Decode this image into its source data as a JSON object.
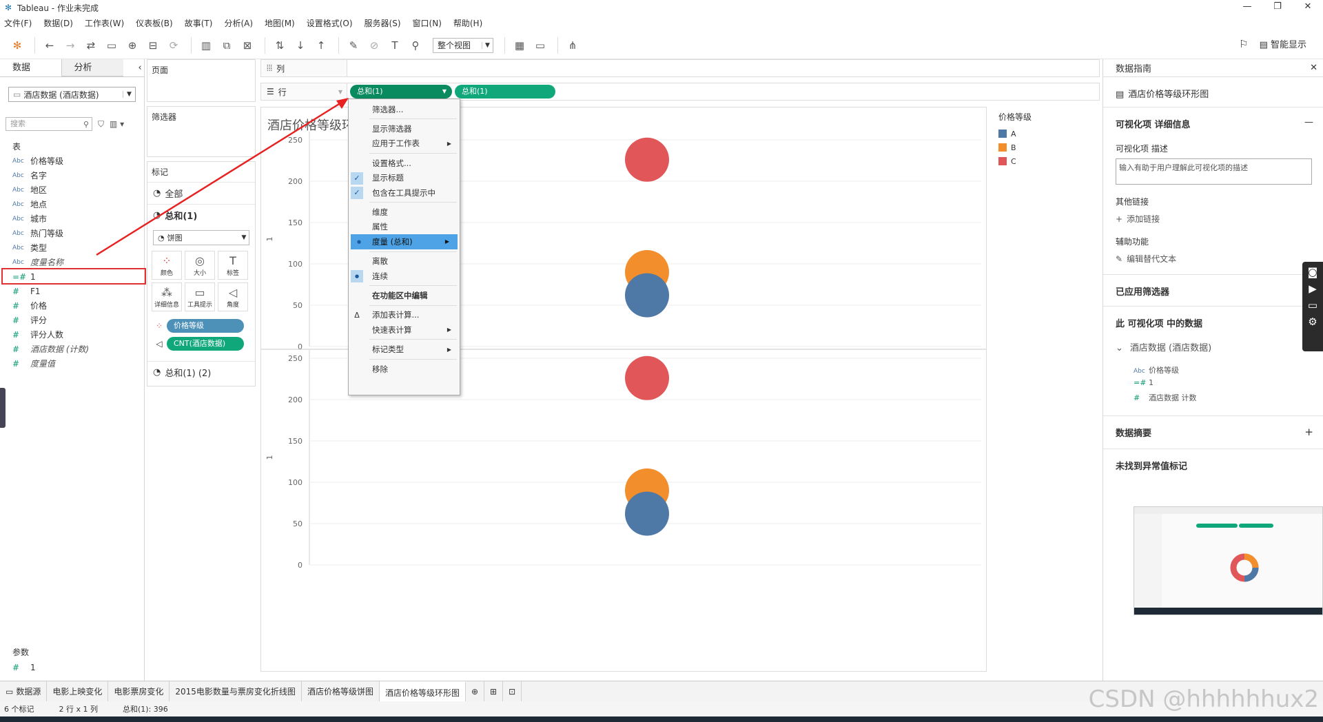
{
  "window": {
    "title": "Tableau - 作业未完成",
    "controls": [
      "—",
      "❐",
      "✕"
    ]
  },
  "menu": [
    "文件(F)",
    "数据(D)",
    "工作表(W)",
    "仪表板(B)",
    "故事(T)",
    "分析(A)",
    "地图(M)",
    "设置格式(O)",
    "服务器(S)",
    "窗口(N)",
    "帮助(H)"
  ],
  "toolbar": {
    "view_select": "整个视图",
    "smart_show": "智能显示"
  },
  "data_pane": {
    "tab_data": "数据",
    "tab_analysis": "分析",
    "datasource": "酒店数据 (酒店数据)",
    "search_placeholder": "搜索",
    "tables_label": "表",
    "fields": [
      {
        "type": "Abc",
        "name": "价格等级",
        "italic": false
      },
      {
        "type": "Abc",
        "name": "名字",
        "italic": false
      },
      {
        "type": "Abc",
        "name": "地区",
        "italic": false
      },
      {
        "type": "Abc",
        "name": "地点",
        "italic": false
      },
      {
        "type": "Abc",
        "name": "城市",
        "italic": false
      },
      {
        "type": "Abc",
        "name": "热门等级",
        "italic": false
      },
      {
        "type": "Abc",
        "name": "类型",
        "italic": false
      },
      {
        "type": "Abc",
        "name": "度量名称",
        "italic": true
      },
      {
        "type": "=#",
        "name": "1",
        "italic": false
      },
      {
        "type": "#",
        "name": "F1",
        "italic": false
      },
      {
        "type": "#",
        "name": "价格",
        "italic": false
      },
      {
        "type": "#",
        "name": "评分",
        "italic": false
      },
      {
        "type": "#",
        "name": "评分人数",
        "italic": false
      },
      {
        "type": "#",
        "name": "酒店数据 (计数)",
        "italic": true
      },
      {
        "type": "#",
        "name": "度量值",
        "italic": true
      }
    ],
    "params_label": "参数",
    "param": {
      "type": "#",
      "name": "1"
    }
  },
  "cards": {
    "pages": "页面",
    "filters": "筛选器",
    "marks": "标记",
    "marks_all": "全部",
    "marks_sum1": "总和(1)",
    "mark_type": "饼图",
    "mark_buttons": [
      {
        "icon": "color",
        "label": "颜色"
      },
      {
        "icon": "size",
        "label": "大小"
      },
      {
        "icon": "text",
        "label": "标签"
      },
      {
        "icon": "detail",
        "label": "详细信息"
      },
      {
        "icon": "tooltip",
        "label": "工具提示"
      },
      {
        "icon": "angle",
        "label": "角度"
      }
    ],
    "pill_color": "价格等级",
    "pill_angle": "CNT(酒店数据)",
    "marks_sum1_2": "总和(1) (2)"
  },
  "shelves": {
    "columns_label": "列",
    "rows_label": "行",
    "row_pill_1": "总和(1)",
    "row_pill_2": "总和(1)"
  },
  "viz": {
    "title": "酒店价格等级环形图",
    "axis_label": "1"
  },
  "chart_data": {
    "type": "scatter",
    "panes": [
      {
        "ylabel": "1",
        "ylim": [
          0,
          260
        ],
        "yticks": [
          0,
          50,
          100,
          150,
          200,
          250
        ]
      },
      {
        "ylabel": "1",
        "ylim": [
          0,
          260
        ],
        "yticks": [
          0,
          50,
          100,
          150,
          200,
          250
        ]
      }
    ],
    "points": [
      {
        "pane": 0,
        "category": "C",
        "y": 226
      },
      {
        "pane": 0,
        "category": "B",
        "y": 90
      },
      {
        "pane": 0,
        "category": "A",
        "y": 62
      },
      {
        "pane": 1,
        "category": "C",
        "y": 226
      },
      {
        "pane": 1,
        "category": "B",
        "y": 90
      },
      {
        "pane": 1,
        "category": "A",
        "y": 62
      }
    ],
    "colors": {
      "A": "#4e79a7",
      "B": "#f28e2b",
      "C": "#e15759"
    },
    "legend": {
      "title": "价格等级",
      "placement": "right",
      "items": [
        "A",
        "B",
        "C"
      ]
    },
    "grid": true
  },
  "context_menu": [
    {
      "label": "筛选器...",
      "check": false,
      "sub": false,
      "bold": false,
      "hl": false
    },
    {
      "sep": true
    },
    {
      "label": "显示筛选器",
      "check": false,
      "sub": false
    },
    {
      "label": "应用于工作表",
      "check": false,
      "sub": true
    },
    {
      "sep": true
    },
    {
      "label": "设置格式...",
      "check": false,
      "sub": false
    },
    {
      "label": "显示标题",
      "check": true,
      "sub": false
    },
    {
      "label": "包含在工具提示中",
      "check": true,
      "sub": false
    },
    {
      "sep": true
    },
    {
      "label": "维度",
      "check": false,
      "sub": false
    },
    {
      "label": "属性",
      "check": false,
      "sub": false
    },
    {
      "label": "度量 (总和)",
      "dot": true,
      "sub": true,
      "hl": true
    },
    {
      "sep": true
    },
    {
      "label": "离散",
      "check": false,
      "sub": false
    },
    {
      "label": "连续",
      "dot": true,
      "sub": false
    },
    {
      "sep": true
    },
    {
      "label": "在功能区中编辑",
      "bold": true,
      "sub": false
    },
    {
      "sep": true
    },
    {
      "label": "添加表计算...",
      "delta": true,
      "sub": false
    },
    {
      "label": "快速表计算",
      "sub": true
    },
    {
      "sep": true
    },
    {
      "label": "标记类型",
      "sub": true
    },
    {
      "sep": true
    },
    {
      "label": "移除",
      "sub": false
    }
  ],
  "right_pane": {
    "header": "数据指南",
    "sheet_name": "酒店价格等级环形图",
    "viz_detail": "可视化项 详细信息",
    "viz_desc_label": "可视化项 描述",
    "viz_desc_placeholder": "输入有助于用户理解此可视化项的描述",
    "links_label": "其他链接",
    "add_link": "添加链接",
    "accessibility": "辅助功能",
    "edit_alt": "编辑替代文本",
    "applied_filters": "已应用筛选器",
    "data_in_viz": "此 可视化项 中的数据",
    "source": "酒店数据 (酒店数据)",
    "data_fields": [
      {
        "type": "Abc",
        "name": "价格等级"
      },
      {
        "type": "=#",
        "name": "1"
      },
      {
        "type": "#",
        "name": "酒店数据 计数"
      }
    ],
    "summary": "数据摘要",
    "outliers": "未找到异常值标记"
  },
  "sheet_tabs": [
    "数据源",
    "电影上映变化",
    "电影票房变化",
    "2015电影数量与票房变化折线图",
    "酒店价格等级饼图",
    "酒店价格等级环形图"
  ],
  "status": {
    "marks": "6 个标记",
    "rows_cols": "2 行 x 1 列",
    "sum": "总和(1): 396"
  },
  "watermark": "CSDN @hhhhhhux2"
}
